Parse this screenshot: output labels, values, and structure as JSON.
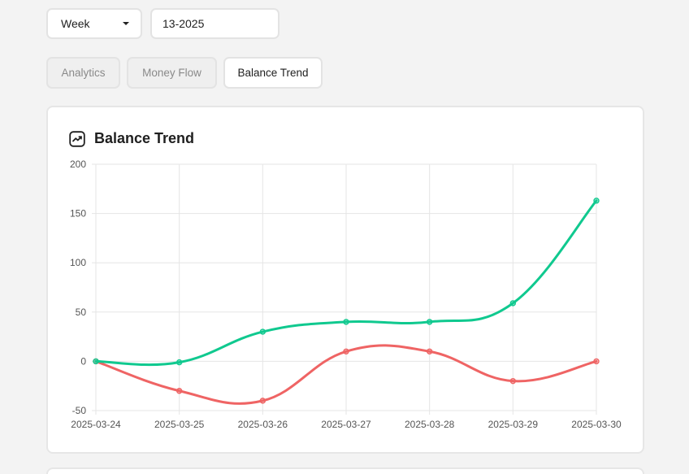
{
  "controls": {
    "period_selected": "Week",
    "week_value": "13-2025"
  },
  "tabs": [
    {
      "label": "Analytics",
      "active": false
    },
    {
      "label": "Money Flow",
      "active": false
    },
    {
      "label": "Balance Trend",
      "active": true
    }
  ],
  "card": {
    "title": "Balance Trend",
    "icon": "trend-icon"
  },
  "colors": {
    "series_green": "#10c98f",
    "series_red": "#ef6464",
    "grid": "#e5e5e5",
    "axis_text": "#555555"
  },
  "chart_data": {
    "type": "line",
    "x": [
      "2025-03-24",
      "2025-03-25",
      "2025-03-26",
      "2025-03-27",
      "2025-03-28",
      "2025-03-29",
      "2025-03-30"
    ],
    "series": [
      {
        "values": [
          0,
          -1,
          30,
          40,
          40,
          59,
          163
        ],
        "color": "#10c98f"
      },
      {
        "values": [
          0,
          -30,
          -40,
          10,
          10,
          -20,
          0
        ],
        "color": "#ef6464"
      }
    ],
    "ylim": [
      -50,
      200
    ],
    "yticks": [
      200,
      150,
      100,
      50,
      0,
      -50
    ],
    "grid": true,
    "legend": false,
    "title": "",
    "xlabel": "",
    "ylabel": ""
  }
}
